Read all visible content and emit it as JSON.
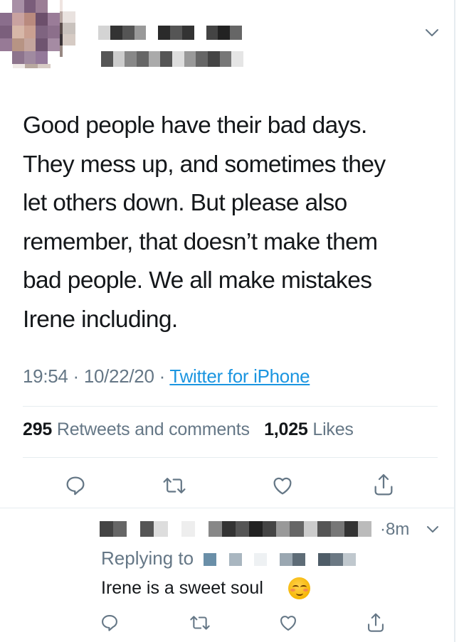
{
  "tweet": {
    "text": "Good people have their bad days.\nThey mess up, and sometimes they\nlet others down. But please also\nremember, that doesn’t make them\nbad people. We all make mistakes\nIrene including.",
    "time": "19:54",
    "date": "10/22/20",
    "source": "Twitter for iPhone",
    "retweets_count": "295",
    "retweets_label": "Retweets and comments",
    "likes_count": "1,025",
    "likes_label": "Likes"
  },
  "reply": {
    "time": "·8m",
    "replying_label": "Replying to",
    "text": "Irene is a sweet soul",
    "emoji": "smiling-face-with-blushing-cheeks"
  },
  "icons": {
    "more": "chevron-down-icon",
    "reply": "reply-icon",
    "retweet": "retweet-icon",
    "like": "heart-icon",
    "share": "share-icon"
  },
  "colors": {
    "text": "#14171a",
    "secondary": "#657786",
    "link": "#1b95e0",
    "divider": "#e6ecf0"
  }
}
